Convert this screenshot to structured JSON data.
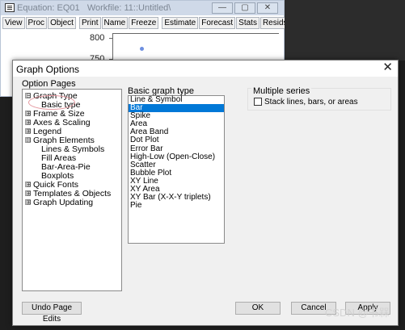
{
  "bg_window": {
    "title": "Equation: EQ01   Workfile: 11::Untitled\\",
    "win_buttons": [
      "—",
      "▢",
      "✕"
    ],
    "toolbar": [
      "View",
      "Proc",
      "Object",
      "Print",
      "Name",
      "Freeze",
      "Estimate",
      "Forecast",
      "Stats",
      "Resids"
    ],
    "y_ticks": [
      "800",
      "750"
    ]
  },
  "dialog": {
    "title": "Graph Options",
    "close_icon": "✕",
    "option_pages_label": "Option Pages",
    "tree": [
      {
        "label": "Graph Type",
        "box": "⊟"
      },
      {
        "label": "Basic type",
        "box": ""
      },
      {
        "label": "Frame & Size",
        "box": "⊞"
      },
      {
        "label": "Axes & Scaling",
        "box": "⊞"
      },
      {
        "label": "Legend",
        "box": "⊞"
      },
      {
        "label": "Graph Elements",
        "box": "⊟"
      },
      {
        "label": "Lines & Symbols",
        "box": ""
      },
      {
        "label": "Fill Areas",
        "box": ""
      },
      {
        "label": "Bar-Area-Pie",
        "box": ""
      },
      {
        "label": "Boxplots",
        "box": ""
      },
      {
        "label": "Quick Fonts",
        "box": "⊞"
      },
      {
        "label": "Templates & Objects",
        "box": "⊞"
      },
      {
        "label": "Graph Updating",
        "box": "⊞"
      }
    ],
    "basic_graph_type_label": "Basic graph type",
    "graph_types": [
      "Line & Symbol",
      "Bar",
      "Spike",
      "Area",
      "Area Band",
      "Dot Plot",
      "Error Bar",
      "High-Low (Open-Close)",
      "Scatter",
      "Bubble Plot",
      "XY Line",
      "XY Area",
      "XY Bar (X-X-Y triplets)",
      "Pie"
    ],
    "selected_graph_type": "Bar",
    "multiple_series_label": "Multiple series",
    "stack_label": "Stack lines, bars, or areas",
    "stack_checked": false,
    "buttons": {
      "undo": "Undo Page Edits",
      "ok": "OK",
      "cancel": "Cancel",
      "apply": "Apply"
    },
    "accent_color": "#0078d7"
  },
  "watermark": "CSDN @书槑"
}
